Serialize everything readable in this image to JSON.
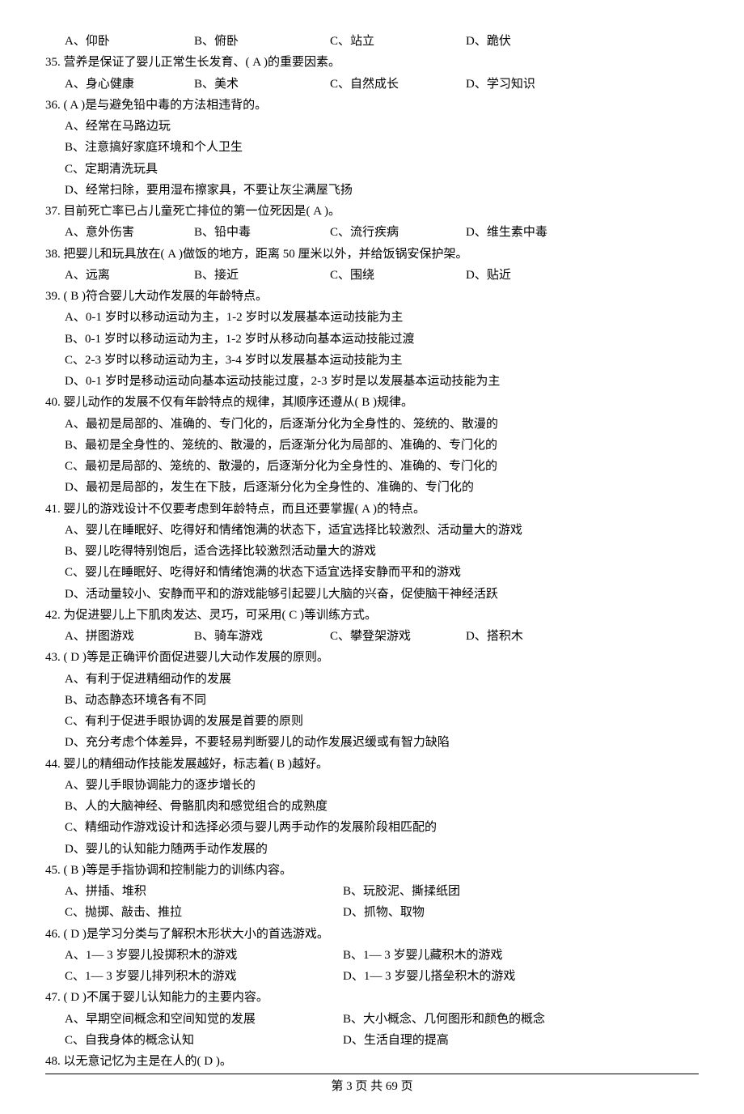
{
  "q34": {
    "optA": "A、仰卧",
    "optB": "B、俯卧",
    "optC": "C、站立",
    "optD": "D、跪伏"
  },
  "q35": {
    "stem": "35. 营养是保证了婴儿正常生长发育、(   A   )的重要因素。",
    "optA": "A、身心健康",
    "optB": "B、美术",
    "optC": "C、自然成长",
    "optD": "D、学习知识"
  },
  "q36": {
    "stem": "36. (  A   )是与避免铅中毒的方法相违背的。",
    "optA": "A、经常在马路边玩",
    "optB": "B、注意搞好家庭环境和个人卫生",
    "optC": "C、定期清洗玩具",
    "optD": "D、经常扫除，要用湿布擦家具，不要让灰尘满屋飞扬"
  },
  "q37": {
    "stem": "37. 目前死亡率已占儿童死亡排位的第一位死因是(   A   )。",
    "optA": "A、意外伤害",
    "optB": "B、铅中毒",
    "optC": "C、流行疾病",
    "optD": "D、维生素中毒"
  },
  "q38": {
    "stem": "38. 把婴儿和玩具放在(   A   )做饭的地方，距离 50 厘米以外，并给饭锅安保护架。",
    "optA": "A、远离",
    "optB": "B、接近",
    "optC": "C、围绕",
    "optD": "D、贴近"
  },
  "q39": {
    "stem": "39. (    B    )符合婴儿大动作发展的年龄特点。",
    "optA": "A、0-1 岁时以移动运动为主，1-2 岁时以发展基本运动技能为主",
    "optB": "B、0-1 岁时以移动运动为主，1-2 岁时从移动向基本运动技能过渡",
    "optC": "C、2-3 岁时以移动运动为主，3-4 岁时以发展基本运动技能为主",
    "optD": "D、0-1 岁时是移动运动向基本运动技能过度，2-3 岁时是以发展基本运动技能为主"
  },
  "q40": {
    "stem": "40. 婴儿动作的发展不仅有年龄特点的规律，其顺序还遵从(   B   )规律。",
    "optA": "A、最初是局部的、准确的、专门化的，后逐渐分化为全身性的、笼统的、散漫的",
    "optB": "B、最初是全身性的、笼统的、散漫的，后逐渐分化为局部的、准确的、专门化的",
    "optC": "C、最初是局部的、笼统的、散漫的，后逐渐分化为全身性的、准确的、专门化的",
    "optD": "D、最初是局部的，发生在下肢，后逐渐分化为全身性的、准确的、专门化的"
  },
  "q41": {
    "stem": "41. 婴儿的游戏设计不仅要考虑到年龄特点，而且还要掌握(    A    )的特点。",
    "optA": "A、婴儿在睡眠好、吃得好和情绪饱满的状态下，适宜选择比较激烈、活动量大的游戏",
    "optB": "B、婴儿吃得特别饱后，适合选择比较激烈活动量大的游戏",
    "optC": "C、婴儿在睡眠好、吃得好和情绪饱满的状态下适宜选择安静而平和的游戏",
    "optD": "D、活动量较小、安静而平和的游戏能够引起婴儿大脑的兴奋，促使脑干神经活跃"
  },
  "q42": {
    "stem": "42. 为促进婴儿上下肌肉发达、灵巧，可采用(    C    )等训练方式。",
    "optA": "A、拼图游戏",
    "optB": "B、骑车游戏",
    "optC": "C、攀登架游戏",
    "optD": "D、搭积木"
  },
  "q43": {
    "stem": "43. (    D    )等是正确评价面促进婴儿大动作发展的原则。",
    "optA": "A、有利于促进精细动作的发展",
    "optB": "B、动态静态环境各有不同",
    "optC": "C、有利于促进手眼协调的发展是首要的原则",
    "optD": "D、充分考虑个体差异，不要轻易判断婴儿的动作发展迟缓或有智力缺陷"
  },
  "q44": {
    "stem": "44. 婴儿的精细动作技能发展越好，标志着(   B   )越好。",
    "optA": "A、婴儿手眼协调能力的逐步增长的",
    "optB": "B、人的大脑神经、骨骼肌肉和感觉组合的成熟度",
    "optC": "C、精细动作游戏设计和选择必须与婴儿两手动作的发展阶段相匹配的",
    "optD": "D、婴儿的认知能力随两手动作发展的"
  },
  "q45": {
    "stem": "45. (    B    )等是手指协调和控制能力的训练内容。",
    "optA": "A、拼插、堆积",
    "optB": "B、玩胶泥、撕揉纸团",
    "optC": "C、抛掷、敲击、推拉",
    "optD": "D、抓物、取物"
  },
  "q46": {
    "stem": "46. (    D    )是学习分类与了解积木形状大小的首选游戏。",
    "optA": "A、1— 3 岁婴儿投掷积木的游戏",
    "optB": "B、1— 3 岁婴儿藏积木的游戏",
    "optC": "C、1— 3 岁婴儿排列积木的游戏",
    "optD": "D、1— 3 岁婴儿搭垒积木的游戏"
  },
  "q47": {
    "stem": "47. (    D    )不属于婴儿认知能力的主要内容。",
    "optA": "A、早期空间概念和空间知觉的发展",
    "optB": "B、大小概念、几何图形和颜色的概念",
    "optC": "C、自我身体的概念认知",
    "optD": "D、生活自理的提高"
  },
  "q48": {
    "stem": "48. 以无意记忆为主是在人的(   D   )。"
  },
  "footer": "第  3  页    共  69  页"
}
